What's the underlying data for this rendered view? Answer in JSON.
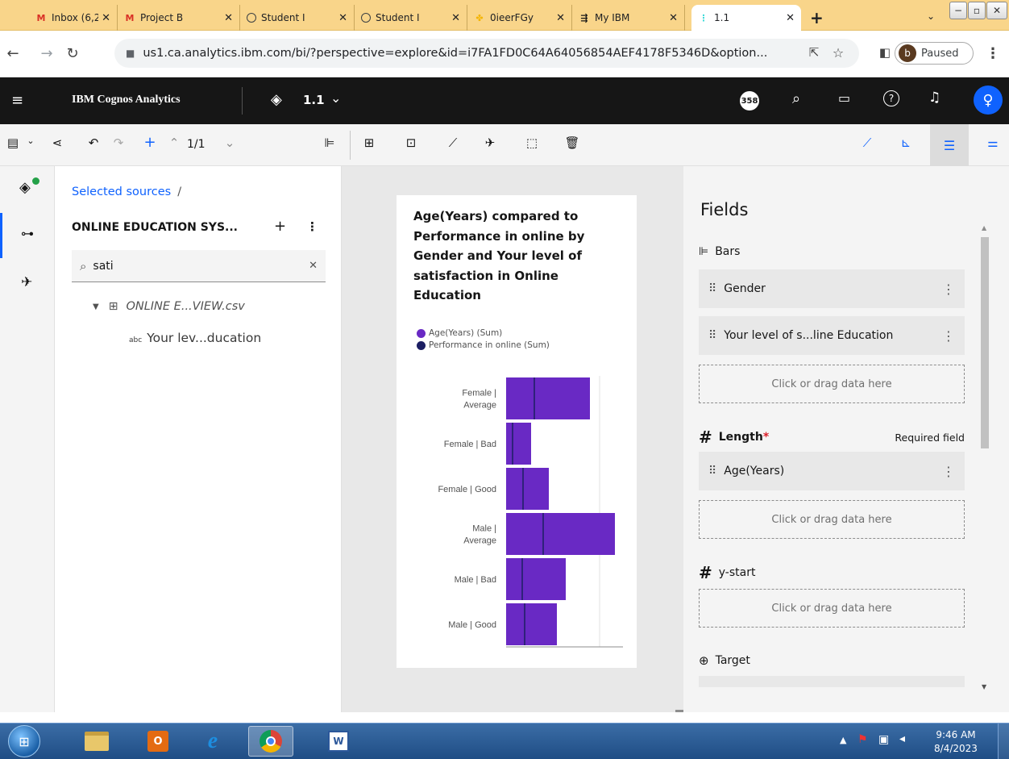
{
  "browser": {
    "tabs": [
      {
        "label": "Inbox (6,2",
        "icon": "gmail-icon",
        "color": "#d93025"
      },
      {
        "label": "Project B",
        "icon": "gmail-icon",
        "color": "#d93025"
      },
      {
        "label": "Student I",
        "icon": "globe-icon",
        "color": "#3c4043"
      },
      {
        "label": "Student I",
        "icon": "globe-icon",
        "color": "#3c4043"
      },
      {
        "label": "0ieerFGy",
        "icon": "pinwheel-icon",
        "color": "#f4b400"
      },
      {
        "label": "My IBM",
        "icon": "ibm-icon",
        "color": "#161616"
      },
      {
        "label": "1.1",
        "icon": "cognos-icon",
        "color": "#3ddbd9"
      }
    ],
    "url": "us1.ca.analytics.ibm.com/bi/?perspective=explore&id=i7FA1FD0C64A64056854AEF4178F5346D&option...",
    "profile_initial": "b",
    "profile_status": "Paused"
  },
  "ibm_header": {
    "app_name": "IBM Cognos Analytics",
    "doc_title": "1.1",
    "notification_count": "358"
  },
  "toolbar": {
    "page_indicator": "1/1"
  },
  "sources": {
    "breadcrumb": "Selected sources",
    "breadcrumb_sep": "/",
    "title": "ONLINE EDUCATION SYS...",
    "search_value": "sati",
    "tree_file": "ONLINE E...VIEW.csv",
    "tree_field_type": "abc",
    "tree_field": "Your lev...ducation"
  },
  "chart_data": {
    "type": "bar",
    "orientation": "horizontal",
    "title": "Age(Years) compared to Performance in online by Gender and Your level of satisfaction in Online Education",
    "categories": [
      "Female | Average",
      "Female | Bad",
      "Female | Good",
      "Male | Average",
      "Male | Bad",
      "Male | Good"
    ],
    "series": [
      {
        "name": "Age(Years) (Sum)",
        "color": "#6929c4",
        "values": [
          104,
          31,
          53,
          135,
          74,
          63
        ]
      },
      {
        "name": "Performance in online (Sum)",
        "color": "#1c1f63",
        "values": [
          35,
          8,
          21,
          46,
          20,
          23
        ]
      }
    ],
    "xlim": [
      0,
      145
    ],
    "grid": true,
    "legend_position": "top-left"
  },
  "fields": {
    "heading": "Fields",
    "bars_label": "Bars",
    "bars_items": [
      "Gender",
      "Your level of s...line Education"
    ],
    "drop_hint": "Click or drag data here",
    "length_label": "Length",
    "required_star": "*",
    "required_text": "Required field",
    "length_items": [
      "Age(Years)"
    ],
    "ystart_label": "y-start",
    "target_label": "Target"
  },
  "taskbar": {
    "time": "9:46 AM",
    "date": "8/4/2023"
  }
}
